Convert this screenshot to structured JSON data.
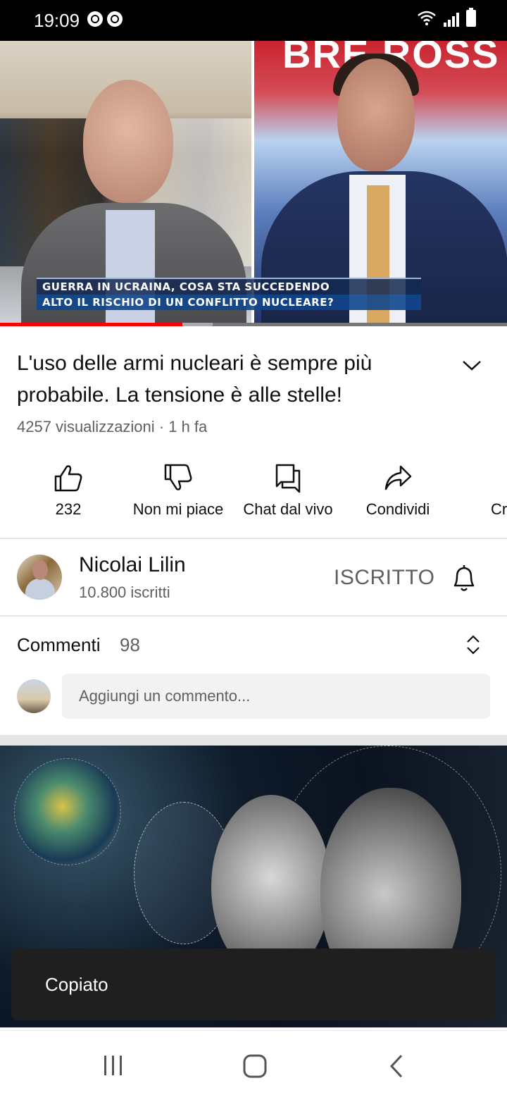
{
  "status_bar": {
    "time": "19:09"
  },
  "video": {
    "overlay_text": "BRE ROSS",
    "caption_line1": "GUERRA IN UCRAINA, COSA STA SUCCEDENDO",
    "caption_line2": "ALTO IL RISCHIO DI UN CONFLITTO NUCLEARE?",
    "progress": {
      "played_fraction": 0.36,
      "buffered_fraction": 0.06
    }
  },
  "title": "L'uso delle armi nucleari è sempre più probabile. La tensione è alle stelle!",
  "meta": "4257 visualizzazioni · 1 h fa",
  "actions": [
    {
      "label": "232",
      "icon": "thumbs-up-icon"
    },
    {
      "label": "Non mi piace",
      "icon": "thumbs-down-icon"
    },
    {
      "label": "Chat dal vivo",
      "icon": "chat-icon"
    },
    {
      "label": "Condividi",
      "icon": "share-icon"
    },
    {
      "label": "Cr",
      "icon": "create-icon"
    }
  ],
  "channel": {
    "name": "Nicolai Lilin",
    "subscribers": "10.800 iscritti",
    "subscribe_state": "ISCRITTO"
  },
  "comments": {
    "label": "Commenti",
    "count": "98",
    "placeholder": "Aggiungi un commento..."
  },
  "toast": {
    "message": "Copiato"
  },
  "colors": {
    "progress_red": "#ff0000",
    "toast_bg": "#1f1f1f",
    "secondary_text": "#606060"
  }
}
